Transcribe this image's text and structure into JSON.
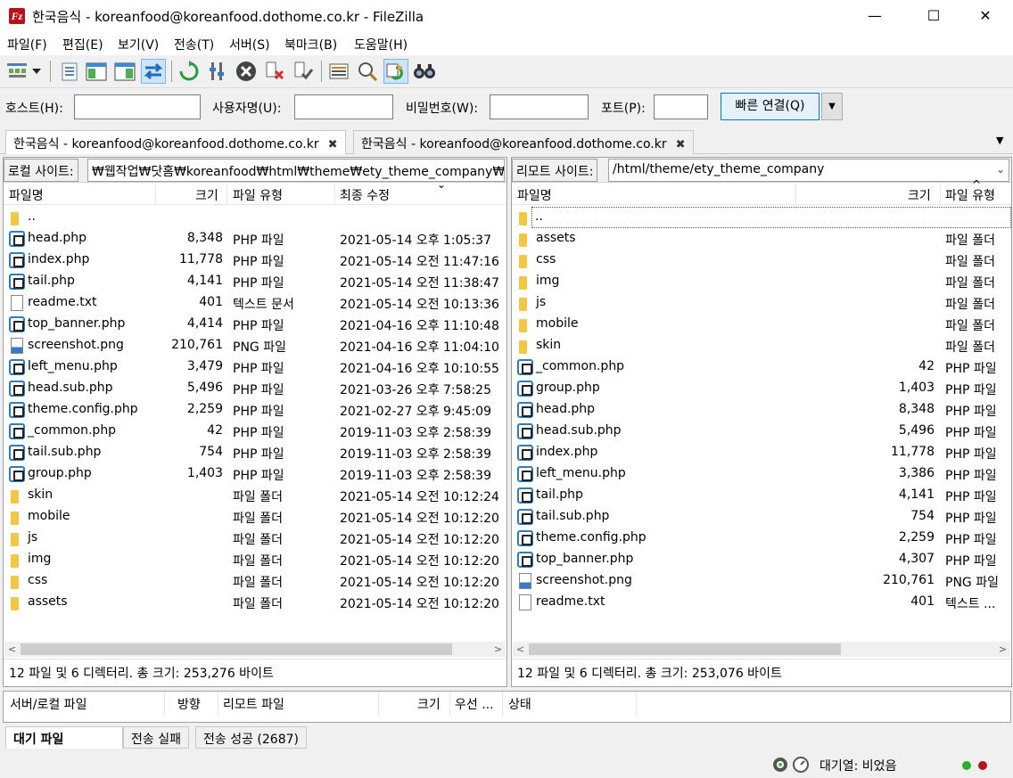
{
  "window": {
    "title": "한국음식 - koreanfood@koreanfood.dothome.co.kr - FileZilla",
    "app_icon_letter": "Fz",
    "minimize": "—",
    "maximize": "☐",
    "close": "✕"
  },
  "menu": [
    "파일(F)",
    "편집(E)",
    "보기(V)",
    "전송(T)",
    "서버(S)",
    "북마크(B)",
    "도움말(H)"
  ],
  "toolbar": {
    "icons": [
      "site-manager-icon",
      "dropdown-arrow-icon",
      "toggle-message-log-icon",
      "toggle-local-tree-icon",
      "toggle-remote-tree-icon",
      "toggle-queue-icon",
      "refresh-icon",
      "filter-icon",
      "cancel-icon",
      "disconnect-icon",
      "reconnect-icon",
      "directory-listing-icon",
      "search-remote-icon",
      "compare-icon",
      "sync-browse-icon",
      "find-files-icon"
    ]
  },
  "quickconnect": {
    "host_label": "호스트(H):",
    "user_label": "사용자명(U):",
    "pass_label": "비밀번호(W):",
    "port_label": "포트(P):",
    "host_value": "",
    "user_value": "",
    "pass_value": "",
    "port_value": "",
    "connect_label": "빠른 연결(Q)",
    "dropdown": "▼"
  },
  "tabs": [
    {
      "label": "한국음식 - koreanfood@koreanfood.dothome.co.kr",
      "close": "✖"
    },
    {
      "label": "한국음식 - koreanfood@koreanfood.dothome.co.kr",
      "close": "✖"
    }
  ],
  "tabs_dropdown": "▼",
  "local": {
    "site_label": "로컬 사이트:",
    "path": "₩웹작업₩닷홈₩koreanfood₩html₩theme₩ety_theme_company₩",
    "headers": {
      "name": "파일명",
      "size": "크기",
      "type": "파일 유형",
      "modified": "최종 수정"
    },
    "sort_indicator": "⌄",
    "rows": [
      {
        "icon": "folder",
        "name": "..",
        "size": "",
        "type": "",
        "modified": ""
      },
      {
        "icon": "php",
        "name": "head.php",
        "size": "8,348",
        "type": "PHP 파일",
        "modified": "2021-05-14 오후 1:05:37"
      },
      {
        "icon": "php",
        "name": "index.php",
        "size": "11,778",
        "type": "PHP 파일",
        "modified": "2021-05-14 오전 11:47:16"
      },
      {
        "icon": "php",
        "name": "tail.php",
        "size": "4,141",
        "type": "PHP 파일",
        "modified": "2021-05-14 오전 11:38:47"
      },
      {
        "icon": "txt",
        "name": "readme.txt",
        "size": "401",
        "type": "텍스트 문서",
        "modified": "2021-05-14 오전 10:13:36"
      },
      {
        "icon": "php",
        "name": "top_banner.php",
        "size": "4,414",
        "type": "PHP 파일",
        "modified": "2021-04-16 오후 11:10:48"
      },
      {
        "icon": "png",
        "name": "screenshot.png",
        "size": "210,761",
        "type": "PNG 파일",
        "modified": "2021-04-16 오후 11:04:10"
      },
      {
        "icon": "php",
        "name": "left_menu.php",
        "size": "3,479",
        "type": "PHP 파일",
        "modified": "2021-04-16 오후 10:10:55"
      },
      {
        "icon": "php",
        "name": "head.sub.php",
        "size": "5,496",
        "type": "PHP 파일",
        "modified": "2021-03-26 오후 7:58:25"
      },
      {
        "icon": "php",
        "name": "theme.config.php",
        "size": "2,259",
        "type": "PHP 파일",
        "modified": "2021-02-27 오후 9:45:09"
      },
      {
        "icon": "php",
        "name": "_common.php",
        "size": "42",
        "type": "PHP 파일",
        "modified": "2019-11-03 오후 2:58:39"
      },
      {
        "icon": "php",
        "name": "tail.sub.php",
        "size": "754",
        "type": "PHP 파일",
        "modified": "2019-11-03 오후 2:58:39"
      },
      {
        "icon": "php",
        "name": "group.php",
        "size": "1,403",
        "type": "PHP 파일",
        "modified": "2019-11-03 오후 2:58:39"
      },
      {
        "icon": "folder",
        "name": "skin",
        "size": "",
        "type": "파일 폴더",
        "modified": "2021-05-14 오전 10:12:24"
      },
      {
        "icon": "folder",
        "name": "mobile",
        "size": "",
        "type": "파일 폴더",
        "modified": "2021-05-14 오전 10:12:20"
      },
      {
        "icon": "folder",
        "name": "js",
        "size": "",
        "type": "파일 폴더",
        "modified": "2021-05-14 오전 10:12:20"
      },
      {
        "icon": "folder",
        "name": "img",
        "size": "",
        "type": "파일 폴더",
        "modified": "2021-05-14 오전 10:12:20"
      },
      {
        "icon": "folder",
        "name": "css",
        "size": "",
        "type": "파일 폴더",
        "modified": "2021-05-14 오전 10:12:20"
      },
      {
        "icon": "folder",
        "name": "assets",
        "size": "",
        "type": "파일 폴더",
        "modified": "2021-05-14 오전 10:12:20"
      }
    ],
    "status": "12 파일 및 6 디렉터리. 총 크기: 253,276 바이트"
  },
  "remote": {
    "site_label": "리모트 사이트:",
    "path": "/html/theme/ety_theme_company",
    "headers": {
      "name": "파일명",
      "size": "크기",
      "type": "파일 유형"
    },
    "sort_indicator": "^",
    "rows": [
      {
        "icon": "folder",
        "name": "..",
        "size": "",
        "type": ""
      },
      {
        "icon": "folder",
        "name": "assets",
        "size": "",
        "type": "파일 폴더"
      },
      {
        "icon": "folder",
        "name": "css",
        "size": "",
        "type": "파일 폴더"
      },
      {
        "icon": "folder",
        "name": "img",
        "size": "",
        "type": "파일 폴더"
      },
      {
        "icon": "folder",
        "name": "js",
        "size": "",
        "type": "파일 폴더"
      },
      {
        "icon": "folder",
        "name": "mobile",
        "size": "",
        "type": "파일 폴더"
      },
      {
        "icon": "folder",
        "name": "skin",
        "size": "",
        "type": "파일 폴더"
      },
      {
        "icon": "php",
        "name": "_common.php",
        "size": "42",
        "type": "PHP 파일"
      },
      {
        "icon": "php",
        "name": "group.php",
        "size": "1,403",
        "type": "PHP 파일"
      },
      {
        "icon": "php",
        "name": "head.php",
        "size": "8,348",
        "type": "PHP 파일"
      },
      {
        "icon": "php",
        "name": "head.sub.php",
        "size": "5,496",
        "type": "PHP 파일"
      },
      {
        "icon": "php",
        "name": "index.php",
        "size": "11,778",
        "type": "PHP 파일"
      },
      {
        "icon": "php",
        "name": "left_menu.php",
        "size": "3,386",
        "type": "PHP 파일"
      },
      {
        "icon": "php",
        "name": "tail.php",
        "size": "4,141",
        "type": "PHP 파일"
      },
      {
        "icon": "php",
        "name": "tail.sub.php",
        "size": "754",
        "type": "PHP 파일"
      },
      {
        "icon": "php",
        "name": "theme.config.php",
        "size": "2,259",
        "type": "PHP 파일"
      },
      {
        "icon": "php",
        "name": "top_banner.php",
        "size": "4,307",
        "type": "PHP 파일"
      },
      {
        "icon": "png",
        "name": "screenshot.png",
        "size": "210,761",
        "type": "PNG 파일"
      },
      {
        "icon": "txt",
        "name": "readme.txt",
        "size": "401",
        "type": "텍스트 ..."
      }
    ],
    "status": "12 파일 및 6 디렉터리. 총 크기: 253,076 바이트"
  },
  "scroll": {
    "left": "<",
    "right": ">"
  },
  "queue": {
    "headers": [
      "서버/로컬 파일",
      "방향",
      "리모트 파일",
      "크기",
      "우선 ...",
      "상태"
    ]
  },
  "queue_tabs": [
    "대기 파일",
    "전송 실패",
    "전송 성공 (2687)"
  ],
  "statusbar": {
    "queue_text": "대기열: 비었음",
    "led_colors": [
      "#2eaa2e",
      "#b01818"
    ]
  }
}
